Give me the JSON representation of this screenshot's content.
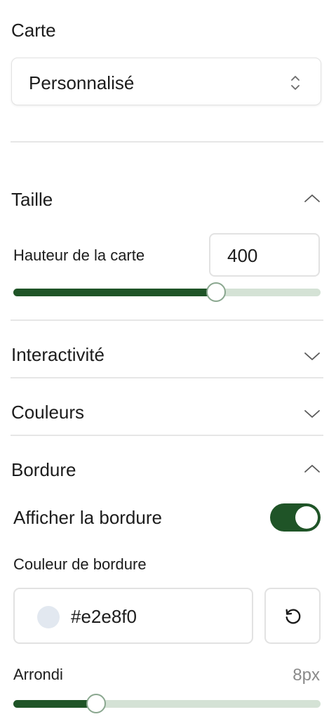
{
  "map_section": {
    "label": "Carte",
    "select_value": "Personnalisé"
  },
  "size_section": {
    "title": "Taille",
    "expanded": true,
    "height_label": "Hauteur de la carte",
    "height_value": "400",
    "height_slider_fraction": 0.66
  },
  "interactivity_section": {
    "title": "Interactivité",
    "expanded": false
  },
  "colors_section": {
    "title": "Couleurs",
    "expanded": false
  },
  "border_section": {
    "title": "Bordure",
    "expanded": true,
    "show_border_label": "Afficher la bordure",
    "show_border_on": true,
    "border_color_label": "Couleur de bordure",
    "border_color_value": "#e2e8f0",
    "radius_label": "Arrondi",
    "radius_value": "8px",
    "radius_slider_fraction": 0.27
  },
  "colors": {
    "accent": "#1f5427",
    "track": "#d4e2d5",
    "swatch": "#e2e8f0"
  },
  "icons": {
    "select": "chevron-up-down-icon",
    "expanded": "chevron-up-icon",
    "collapsed": "chevron-down-icon",
    "reset": "reset-icon"
  }
}
